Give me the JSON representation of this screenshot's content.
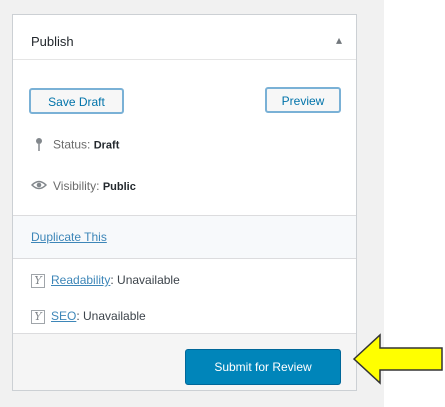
{
  "publish_box": {
    "title": "Publish",
    "collapse_glyph": "▴",
    "save_draft_label": "Save Draft",
    "preview_label": "Preview",
    "status": {
      "label": "Status:",
      "value": "Draft"
    },
    "visibility": {
      "label": "Visibility:",
      "value": "Public"
    },
    "duplicate_link": "Duplicate This",
    "readability": {
      "link": "Readability",
      "value": ": Unavailable"
    },
    "seo": {
      "link": "SEO",
      "value": ": Unavailable"
    },
    "submit_label": "Submit for Review"
  },
  "colors": {
    "accent": "#0085ba",
    "arrow_fill": "#ffff00"
  },
  "icons": [
    "pin-icon",
    "eye-icon",
    "yoast-icon",
    "arrow-icon"
  ]
}
